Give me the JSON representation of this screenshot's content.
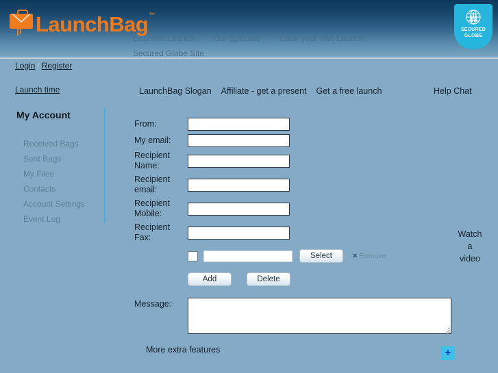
{
  "brand": {
    "name": "LaunchBag",
    "tm": "™",
    "logo_icon": "briefcase-envelope-icon"
  },
  "header": {
    "nav": [
      {
        "label": "Gourmet Launch"
      },
      {
        "label": "Our Specials"
      },
      {
        "label": "Cook your own Launch"
      }
    ],
    "subnav": {
      "label": "Secured Globe Site"
    },
    "badge": {
      "line1": "SECURED",
      "line2": "GLOBE",
      "icon": "globe-shield-icon",
      "color": "#25b5dd"
    }
  },
  "auth": {
    "login": "Login",
    "separator": "/",
    "register": "Register",
    "launch_time": "Launch time"
  },
  "promo": {
    "slogan": "LaunchBag Slogan",
    "affiliate": "Affiliate - get a present",
    "free_launch": "Get a free launch",
    "help_chat": "Help Chat"
  },
  "sidebar": {
    "title": "My Account",
    "items": [
      {
        "label": "Received Bags"
      },
      {
        "label": "Sent Bags"
      },
      {
        "label": "My Files"
      },
      {
        "label": "Contacts"
      },
      {
        "label": "Account Settings"
      },
      {
        "label": "Event Log"
      }
    ]
  },
  "form": {
    "fields": [
      {
        "label": "From:",
        "value": "",
        "placeholder": ""
      },
      {
        "label": "My email:",
        "value": "",
        "placeholder": ""
      },
      {
        "label": "Recipient Name:",
        "value": "",
        "placeholder": ""
      },
      {
        "label": "Recipient email:",
        "value": "",
        "placeholder": ""
      },
      {
        "label": "Recipient Mobile:",
        "value": "",
        "placeholder": ""
      },
      {
        "label": "Recipient Fax:",
        "value": "",
        "placeholder": ""
      }
    ],
    "attachment": {
      "checked": false,
      "file_value": "",
      "select_label": "Select",
      "remove_mark": "×",
      "remove_label": "Remove"
    },
    "add_label": "Add",
    "delete_label": "Delete",
    "message_label": "Message:",
    "message_value": "",
    "more_features": "More extra features",
    "expand_label": "+"
  },
  "aside": {
    "watch_line1": "Watch",
    "watch_line2": "a",
    "watch_line3": "video"
  }
}
